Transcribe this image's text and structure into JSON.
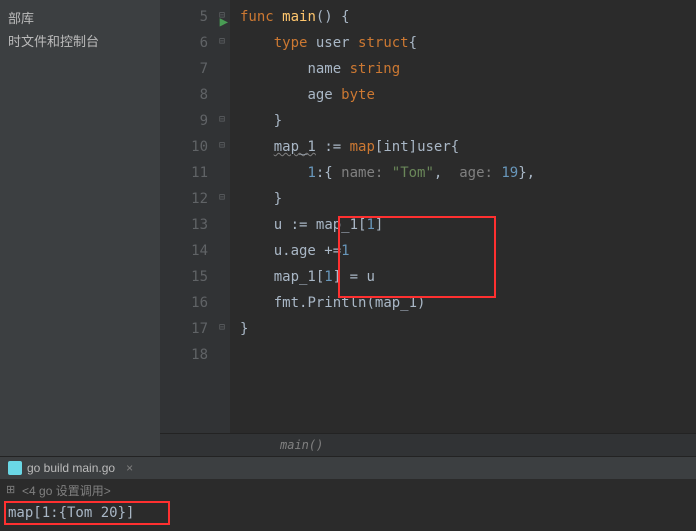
{
  "sidebar": {
    "items": [
      "部库",
      "时文件和控制台"
    ]
  },
  "gutter": {
    "lines": [
      "5",
      "6",
      "7",
      "8",
      "9",
      "10",
      "11",
      "12",
      "13",
      "14",
      "15",
      "16",
      "17",
      "18"
    ]
  },
  "code": {
    "l5": {
      "kw1": "func",
      "name": "main",
      "brace": "() {"
    },
    "l6": {
      "kw1": "type",
      "name": "user",
      "kw2": "struct",
      "brace": "{"
    },
    "l7": {
      "field": "name",
      "ftype": "string"
    },
    "l8": {
      "field": "age",
      "ftype": "byte"
    },
    "l9": {
      "brace": "}"
    },
    "l10": {
      "var": "map_1",
      "op": ":=",
      "kw": "map",
      "idx": "[int]",
      "tp": "user",
      "brace": "{"
    },
    "l11": {
      "key": "1",
      "colon": ":{",
      "p1": "name:",
      "v1": "\"Tom\"",
      "comma": ",",
      "p2": "age:",
      "v2": "19",
      "end": "},"
    },
    "l12": {
      "brace": "}"
    },
    "l13": {
      "var": "u",
      "op": ":=",
      "rhs": "map_1[",
      "idx": "1",
      "close": "]"
    },
    "l14": {
      "lhs": "u.age ",
      "op": "+=",
      "rhs": "1"
    },
    "l15": {
      "lhs": "map_1[",
      "idx": "1",
      "close": "] = u"
    },
    "l16": {
      "pkg": "fmt",
      "dot": ".",
      "fn": "Println",
      "args": "(map_1)"
    },
    "l17": {
      "brace": "}"
    }
  },
  "breadcrumb": {
    "text": "main()"
  },
  "terminal": {
    "tab": {
      "label": "go build main.go"
    },
    "sub": {
      "text": "<4 go 设置调用>"
    },
    "output": {
      "text": "map[1:{Tom 20}]"
    }
  }
}
